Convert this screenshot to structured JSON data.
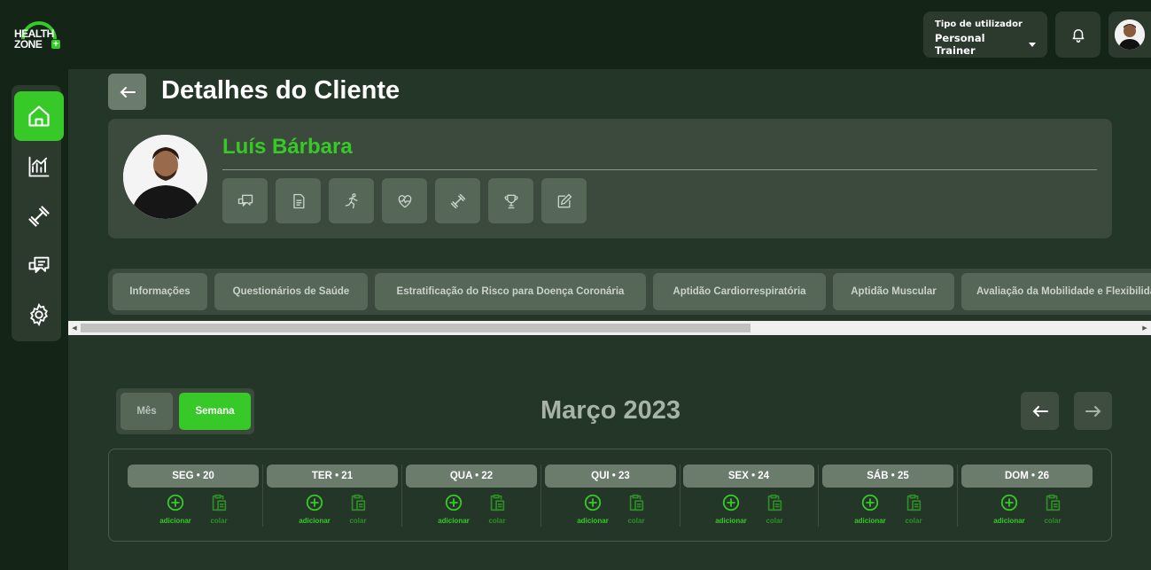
{
  "brand": {
    "line1": "HEALTH",
    "line2": "ZONE",
    "plus": "+"
  },
  "header": {
    "user_type_label": "Tipo de utilizador",
    "user_type_value": "Personal Trainer"
  },
  "sidebar": {
    "items": [
      {
        "icon": "home-icon",
        "active": true
      },
      {
        "icon": "chart-icon",
        "active": false
      },
      {
        "icon": "dumbbell-icon",
        "active": false
      },
      {
        "icon": "chat-icon",
        "active": false
      },
      {
        "icon": "gear-icon",
        "active": false
      }
    ]
  },
  "page": {
    "title": "Detalhes do Cliente"
  },
  "client": {
    "name": "Luís Bárbara",
    "actions": [
      "chat-icon",
      "document-icon",
      "running-icon",
      "heart-rate-icon",
      "dumbbell-icon",
      "trophy-icon",
      "edit-icon"
    ]
  },
  "tabs": [
    "Informações",
    "Questionários de Saúde",
    "Estratificação do Risco para Doença Coronária",
    "Aptidão Cardiorrespiratória",
    "Aptidão Muscular",
    "Avaliação da Mobilidade e Flexibilidade"
  ],
  "calendar": {
    "view_options": [
      "Mês",
      "Semana"
    ],
    "selected_view": "Semana",
    "month_label": "Março 2023",
    "add_label": "adicionar",
    "paste_label": "colar",
    "days": [
      "SEG • 20",
      "TER • 21",
      "QUA • 22",
      "QUI • 23",
      "SEX • 24",
      "SÁB • 25",
      "DOM • 26"
    ]
  },
  "colors": {
    "accent": "#36c928",
    "background": "#16261a",
    "panel": "#3b4a3d"
  }
}
